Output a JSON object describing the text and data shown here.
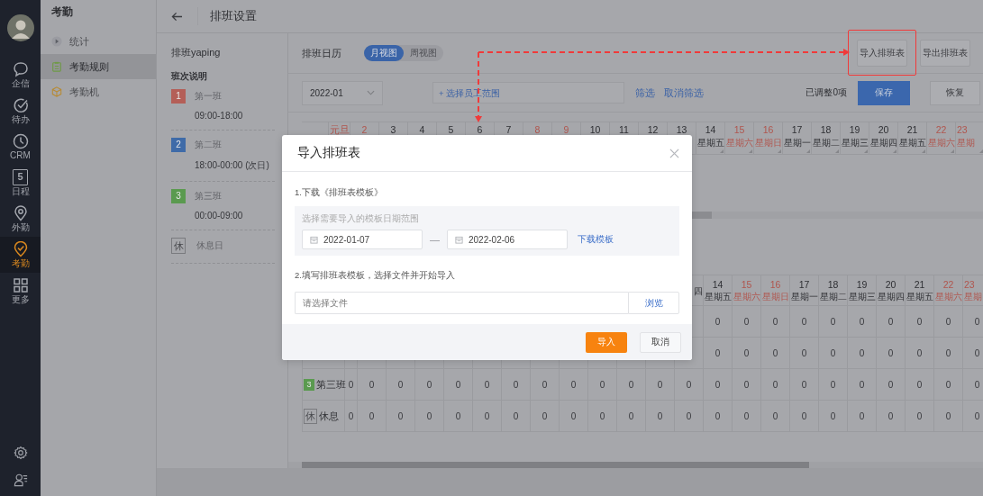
{
  "rail": {
    "items": [
      {
        "kind": "chat",
        "label": "企信",
        "selected": false
      },
      {
        "kind": "todo",
        "label": "待办",
        "selected": false
      },
      {
        "kind": "clock",
        "label": "CRM",
        "selected": false
      },
      {
        "kind": "calendar",
        "label": "日程",
        "icon_text": "5",
        "selected": false
      },
      {
        "kind": "pin",
        "label": "外勤",
        "selected": false
      },
      {
        "kind": "attendance",
        "label": "考勤",
        "selected": true
      },
      {
        "kind": "grid",
        "label": "更多",
        "selected": false
      }
    ]
  },
  "nav": {
    "title": "考勤",
    "items": [
      {
        "kind": "stats",
        "label": "统计",
        "selected": false
      },
      {
        "kind": "rules",
        "label": "考勤规则",
        "selected": true
      },
      {
        "kind": "machine",
        "label": "考勤机",
        "selected": false
      }
    ]
  },
  "header": {
    "title": "排班设置"
  },
  "schedule": {
    "name": "排班yaping",
    "legend_title": "班次说明",
    "shifts": [
      {
        "kind": "shift",
        "badge": "1",
        "color": "#b45f58",
        "name": "第一班",
        "time": "09:00-18:00"
      },
      {
        "kind": "shift",
        "badge": "2",
        "color": "#3f6ba8",
        "name": "第二班",
        "time": "18:00-00:00 (次日)"
      },
      {
        "kind": "shift",
        "badge": "3",
        "color": "#5a9a4f",
        "name": "第三班",
        "time": "00:00-09:00"
      },
      {
        "kind": "rest",
        "badge": "休",
        "name": "休息日"
      }
    ]
  },
  "calendar": {
    "title": "排班日历",
    "views": [
      {
        "label": "月视图",
        "selected": true
      },
      {
        "label": "周视图",
        "selected": false
      }
    ],
    "actions": [
      "导入排班表",
      "导出排班表"
    ],
    "month": "2022-01",
    "staff_filter": {
      "placeholder": "+ 选择员工范围"
    },
    "filter_links": [
      "筛选",
      "取消筛选"
    ],
    "adjusted": "已调整0项",
    "save": "保存",
    "restore": "恢复",
    "top_table": {
      "columns": [
        {
          "day": "元旦",
          "weekend": true
        },
        {
          "day": "2",
          "weekend": true
        },
        {
          "day": "3",
          "weekend": false
        },
        {
          "day": "4",
          "weekend": false
        },
        {
          "day": "5",
          "weekend": false
        },
        {
          "day": "6",
          "weekend": false
        },
        {
          "day": "7",
          "weekend": false
        },
        {
          "day": "8",
          "weekend": true
        },
        {
          "day": "9",
          "weekend": true
        },
        {
          "day": "10",
          "weekend": false
        },
        {
          "day": "11",
          "weekend": false
        },
        {
          "day": "12",
          "weekend": false
        },
        {
          "day": "13",
          "weekend": false
        },
        {
          "day": "14",
          "weekday": "星期五",
          "weekend": false
        },
        {
          "day": "15",
          "weekday": "星期六",
          "weekend": true
        },
        {
          "day": "16",
          "weekday": "星期日",
          "weekend": true
        },
        {
          "day": "17",
          "weekday": "星期一",
          "weekend": false
        },
        {
          "day": "18",
          "weekday": "星期二",
          "weekend": false
        },
        {
          "day": "19",
          "weekday": "星期三",
          "weekend": false
        },
        {
          "day": "20",
          "weekday": "星期四",
          "weekend": false
        },
        {
          "day": "21",
          "weekday": "星期五",
          "weekend": false
        },
        {
          "day": "22",
          "weekday": "星期六",
          "weekend": true
        },
        {
          "day": "23",
          "weekday": "星期",
          "weekend": true
        }
      ]
    },
    "lower_table": {
      "columns": [
        {
          "weekday": "四",
          "weekend": false
        },
        {
          "day": "14",
          "weekday": "星期五",
          "weekend": false
        },
        {
          "day": "15",
          "weekday": "星期六",
          "weekend": true
        },
        {
          "day": "16",
          "weekday": "星期日",
          "weekend": true
        },
        {
          "day": "17",
          "weekday": "星期一",
          "weekend": false
        },
        {
          "day": "18",
          "weekday": "星期二",
          "weekend": false
        },
        {
          "day": "19",
          "weekday": "星期三",
          "weekend": false
        },
        {
          "day": "20",
          "weekday": "星期四",
          "weekend": false
        },
        {
          "day": "21",
          "weekday": "星期五",
          "weekend": false
        },
        {
          "day": "22",
          "weekday": "星期六",
          "weekend": true
        },
        {
          "day": "23",
          "weekday": "星期",
          "weekend": true
        }
      ],
      "rows": [
        {
          "kind": "shift",
          "values": [
            "0",
            "0",
            "0",
            "0",
            "0",
            "0",
            "0",
            "0",
            "0",
            "0"
          ]
        },
        {
          "kind": "shift",
          "values": [
            "0",
            "0",
            "0",
            "0",
            "0",
            "0",
            "0",
            "0",
            "0",
            "0"
          ]
        },
        {
          "kind": "shift",
          "color": "#5a9a4f",
          "badge": "3",
          "name": "第三班",
          "values": [
            "0",
            "0",
            "0",
            "0",
            "0",
            "0",
            "0",
            "0",
            "0",
            "0",
            "0",
            "0",
            "0",
            "0",
            "0",
            "0",
            "0",
            "0",
            "0",
            "0",
            "0",
            "0",
            "0"
          ]
        },
        {
          "kind": "rest",
          "badge": "休",
          "name": "休息",
          "values": [
            "0",
            "0",
            "0",
            "0",
            "0",
            "0",
            "0",
            "0",
            "0",
            "0",
            "0",
            "0",
            "0",
            "0",
            "0",
            "0",
            "0",
            "0",
            "0",
            "0",
            "0",
            "0",
            "0"
          ]
        }
      ]
    }
  },
  "dialog": {
    "title": "导入排班表",
    "step1": "1.下载《排班表模板》",
    "range_label": "选择需要导入的模板日期范围",
    "start_date": "2022-01-07",
    "separator": "—",
    "end_date": "2022-02-06",
    "download_link": "下载模板",
    "step2": "2.填写排班表模板，选择文件并开始导入",
    "file_field": {
      "placeholder": "请选择文件"
    },
    "browse": "浏览",
    "confirm": "导入",
    "cancel": "取消"
  }
}
